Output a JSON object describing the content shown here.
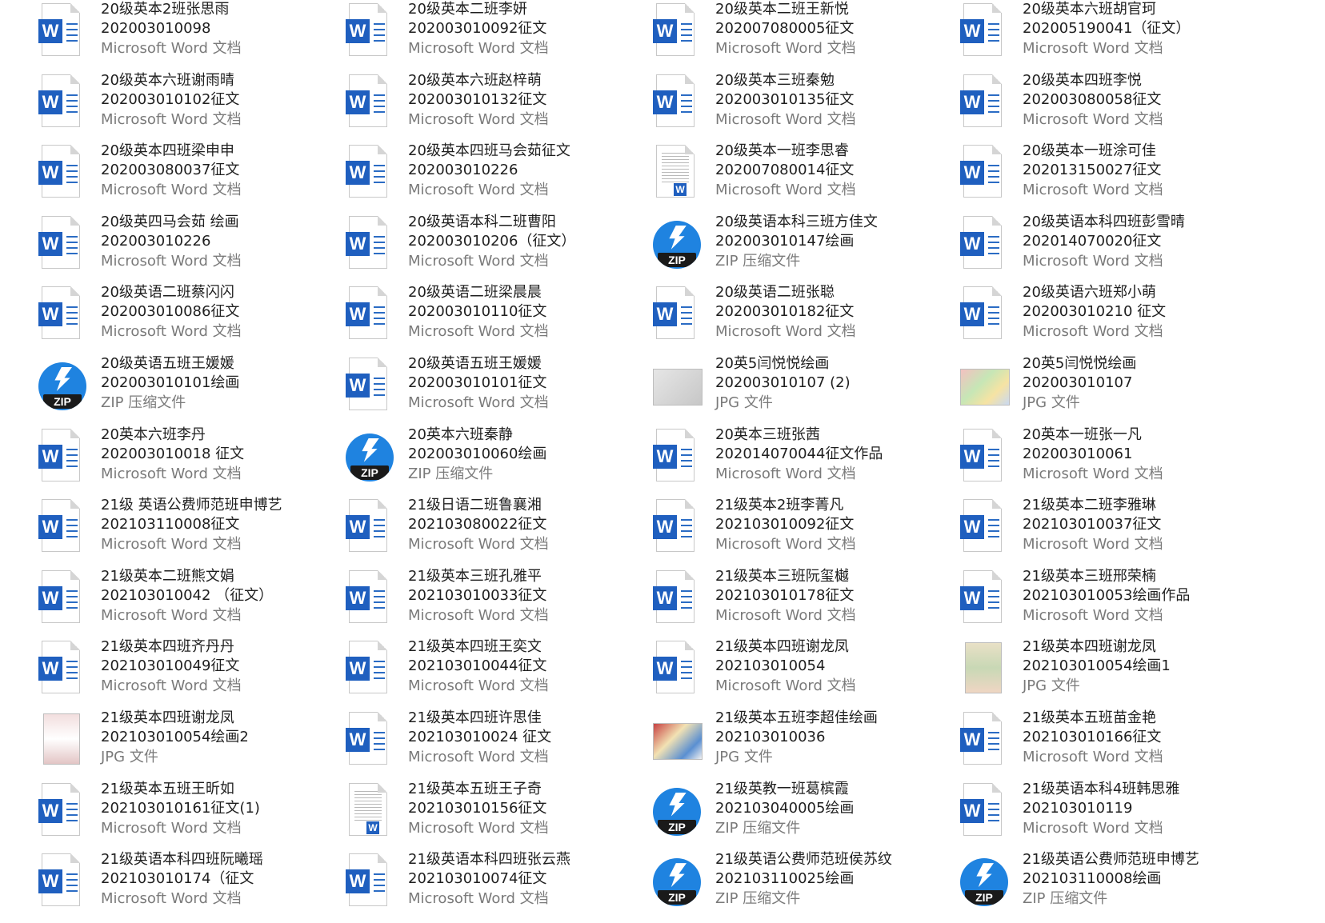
{
  "files": [
    {
      "l1": "20级英本2班张思雨",
      "l2": "202003010098",
      "l3": "Microsoft Word 文档",
      "icon": "word"
    },
    {
      "l1": "20级英本二班李妍",
      "l2": "202003010092征文",
      "l3": "Microsoft Word 文档",
      "icon": "word"
    },
    {
      "l1": "20级英本二班王新悦",
      "l2": "202007080005征文",
      "l3": "Microsoft Word 文档",
      "icon": "word"
    },
    {
      "l1": "20级英本六班胡官珂",
      "l2": "202005190041（征文）",
      "l3": "Microsoft Word 文档",
      "icon": "word"
    },
    {
      "l1": "20级英本六班谢雨晴",
      "l2": "202003010102征文",
      "l3": "Microsoft Word 文档",
      "icon": "word"
    },
    {
      "l1": "20级英本六班赵梓萌",
      "l2": "202003010132征文",
      "l3": "Microsoft Word 文档",
      "icon": "word"
    },
    {
      "l1": "20级英本三班秦勉",
      "l2": "202003010135征文",
      "l3": "Microsoft Word 文档",
      "icon": "word"
    },
    {
      "l1": "20级英本四班李悦",
      "l2": "202003080058征文",
      "l3": "Microsoft Word 文档",
      "icon": "word"
    },
    {
      "l1": "20级英本四班梁申申",
      "l2": "202003080037征文",
      "l3": "Microsoft Word 文档",
      "icon": "word"
    },
    {
      "l1": "20级英本四班马会茹征文",
      "l2": "202003010226",
      "l3": "Microsoft Word 文档",
      "icon": "word"
    },
    {
      "l1": "20级英本一班李思睿",
      "l2": "202007080014征文",
      "l3": "Microsoft Word 文档",
      "icon": "word-preview"
    },
    {
      "l1": "20级英本一班涂可佳",
      "l2": "202013150027征文",
      "l3": "Microsoft Word 文档",
      "icon": "word"
    },
    {
      "l1": "20级英四马会茹 绘画",
      "l2": "202003010226",
      "l3": "Microsoft Word 文档",
      "icon": "word"
    },
    {
      "l1": "20级英语本科二班曹阳",
      "l2": "202003010206（征文）",
      "l3": "Microsoft Word 文档",
      "icon": "word"
    },
    {
      "l1": "20级英语本科三班方佳文",
      "l2": "202003010147绘画",
      "l3": "ZIP 压缩文件",
      "icon": "zip"
    },
    {
      "l1": "20级英语本科四班彭雪晴",
      "l2": "202014070020征文",
      "l3": "Microsoft Word 文档",
      "icon": "word"
    },
    {
      "l1": "20级英语二班蔡闪闪",
      "l2": "202003010086征文",
      "l3": "Microsoft Word 文档",
      "icon": "word"
    },
    {
      "l1": "20级英语二班梁晨晨",
      "l2": "202003010110征文",
      "l3": "Microsoft Word 文档",
      "icon": "word"
    },
    {
      "l1": "20级英语二班张聪",
      "l2": "202003010182征文",
      "l3": "Microsoft Word 文档",
      "icon": "word"
    },
    {
      "l1": "20级英语六班郑小萌",
      "l2": "202003010210 征文",
      "l3": "Microsoft Word 文档",
      "icon": "word"
    },
    {
      "l1": "20级英语五班王媛媛",
      "l2": "202003010101绘画",
      "l3": "ZIP 压缩文件",
      "icon": "zip"
    },
    {
      "l1": "20级英语五班王媛媛",
      "l2": "202003010101征文",
      "l3": "Microsoft Word 文档",
      "icon": "word"
    },
    {
      "l1": "20英5闫悦悦绘画",
      "l2": "202003010107 (2)",
      "l3": "JPG 文件",
      "icon": "jpg-land-gray"
    },
    {
      "l1": "20英5闫悦悦绘画",
      "l2": "202003010107",
      "l3": "JPG 文件",
      "icon": "jpg-land-col1"
    },
    {
      "l1": "20英本六班李丹",
      "l2": "202003010018 征文",
      "l3": "Microsoft Word 文档",
      "icon": "word"
    },
    {
      "l1": "20英本六班秦静",
      "l2": "202003010060绘画",
      "l3": "ZIP 压缩文件",
      "icon": "zip"
    },
    {
      "l1": "20英本三班张茜",
      "l2": "202014070044征文作品",
      "l3": "Microsoft Word 文档",
      "icon": "word"
    },
    {
      "l1": "20英本一班张一凡",
      "l2": "202003010061",
      "l3": "Microsoft Word 文档",
      "icon": "word"
    },
    {
      "l1": "21级 英语公费师范班申博艺",
      "l2": "202103110008征文",
      "l3": "Microsoft Word 文档",
      "icon": "word"
    },
    {
      "l1": "21级日语二班鲁襄湘",
      "l2": "202103080022征文",
      "l3": "Microsoft Word 文档",
      "icon": "word"
    },
    {
      "l1": "21级英本2班李菁凡",
      "l2": "202103010092征文",
      "l3": "Microsoft Word 文档",
      "icon": "word"
    },
    {
      "l1": "21级英本二班李雅琳",
      "l2": "202103010037征文",
      "l3": "Microsoft Word 文档",
      "icon": "word"
    },
    {
      "l1": "21级英本二班熊文娟",
      "l2": "202103010042 （征文）",
      "l3": "Microsoft Word 文档",
      "icon": "word"
    },
    {
      "l1": "21级英本三班孔雅平",
      "l2": "202103010033征文",
      "l3": "Microsoft Word 文档",
      "icon": "word"
    },
    {
      "l1": "21级英本三班阮玺樾",
      "l2": "202103010178征文",
      "l3": "Microsoft Word 文档",
      "icon": "word"
    },
    {
      "l1": "21级英本三班邢荣楠",
      "l2": "202103010053绘画作品",
      "l3": "Microsoft Word 文档",
      "icon": "word"
    },
    {
      "l1": "21级英本四班齐丹丹",
      "l2": "202103010049征文",
      "l3": "Microsoft Word 文档",
      "icon": "word"
    },
    {
      "l1": "21级英本四班王奕文",
      "l2": "202103010044征文",
      "l3": "Microsoft Word 文档",
      "icon": "word"
    },
    {
      "l1": "21级英本四班谢龙凤",
      "l2": "202103010054",
      "l3": "Microsoft Word 文档",
      "icon": "word"
    },
    {
      "l1": "21级英本四班谢龙凤",
      "l2": "202103010054绘画1",
      "l3": "JPG 文件",
      "icon": "jpg-port-col2"
    },
    {
      "l1": "21级英本四班谢龙凤",
      "l2": "202103010054绘画2",
      "l3": "JPG 文件",
      "icon": "jpg-port-col3"
    },
    {
      "l1": "21级英本四班许思佳",
      "l2": "202103010024 征文",
      "l3": "Microsoft Word 文档",
      "icon": "word"
    },
    {
      "l1": "21级英本五班李超佳绘画",
      "l2": "202103010036",
      "l3": "JPG 文件",
      "icon": "jpg-land-col4"
    },
    {
      "l1": "21级英本五班苗金艳",
      "l2": "202103010166征文",
      "l3": "Microsoft Word 文档",
      "icon": "word"
    },
    {
      "l1": "21级英本五班王昕如",
      "l2": "202103010161征文(1)",
      "l3": "Microsoft Word 文档",
      "icon": "word"
    },
    {
      "l1": "21级英本五班王子奇",
      "l2": "202103010156征文",
      "l3": "Microsoft Word 文档",
      "icon": "word-preview"
    },
    {
      "l1": "21级英教一班葛槟霞",
      "l2": "202103040005绘画",
      "l3": "ZIP 压缩文件",
      "icon": "zip"
    },
    {
      "l1": "21级英语本科4班韩思雅",
      "l2": "202103010119",
      "l3": "Microsoft Word 文档",
      "icon": "word"
    },
    {
      "l1": "21级英语本科四班阮曦瑶",
      "l2": "202103010174（征文",
      "l3": "Microsoft Word 文档",
      "icon": "word"
    },
    {
      "l1": "21级英语本科四班张云燕",
      "l2": "202103010074征文",
      "l3": "Microsoft Word 文档",
      "icon": "word"
    },
    {
      "l1": "21级英语公费师范班侯苏纹",
      "l2": "202103110025绘画",
      "l3": "ZIP 压缩文件",
      "icon": "zip"
    },
    {
      "l1": "21级英语公费师范班申博艺",
      "l2": "202103110008绘画",
      "l3": "ZIP 压缩文件",
      "icon": "zip"
    }
  ]
}
